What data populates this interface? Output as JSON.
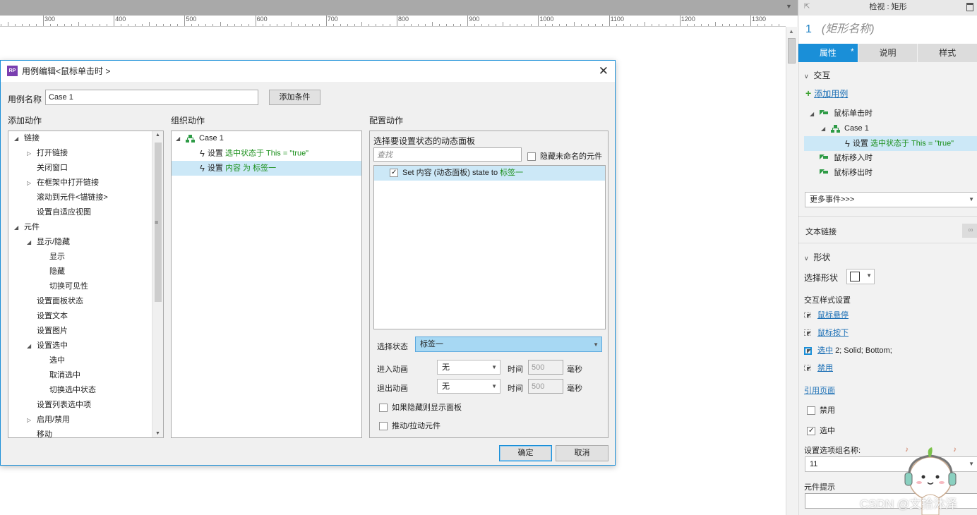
{
  "ruler": {
    "labels": [
      "300",
      "400",
      "500",
      "600",
      "700",
      "800",
      "900",
      "1000",
      "1100",
      "1200",
      "1300"
    ]
  },
  "panel": {
    "header_title": "检视 : 矩形",
    "widget_index": "1",
    "widget_name_placeholder": "(矩形名称)",
    "tabs": [
      {
        "label": "属性",
        "active": true,
        "modified": "*"
      },
      {
        "label": "说明"
      },
      {
        "label": "样式"
      }
    ],
    "interaction_section": "交互",
    "add_case_label": "添加用例",
    "events": [
      {
        "label": "鼠标单击时"
      },
      {
        "label": "鼠标移入时"
      },
      {
        "label": "鼠标移出时"
      }
    ],
    "case_label": "Case 1",
    "action": {
      "prefix": "设置",
      "text": "选中状态于 This = \"true\""
    },
    "more_events": "更多事件>>>",
    "text_link_label": "文本链接",
    "shape_section": "形状",
    "select_shape_label": "选择形状",
    "interaction_styles_label": "交互样式设置",
    "styles": [
      {
        "label": "鼠标悬停",
        "detail": ""
      },
      {
        "label": "鼠标按下",
        "detail": ""
      },
      {
        "label": "选中",
        "detail": "2; Solid; Bottom;"
      },
      {
        "label": "禁用",
        "detail": ""
      }
    ],
    "reference_page": "引用页面",
    "disabled_label": "禁用",
    "selected_label": "选中",
    "group_name_label": "设置选项组名称:",
    "group_name_value": "11",
    "tooltip_label": "元件提示"
  },
  "dialog": {
    "title": "用例编辑<鼠标单击时 >",
    "rp_icon": "RP",
    "case_name_label": "用例名称",
    "case_name_value": "Case 1",
    "add_condition": "添加条件",
    "add_action_header": "添加动作",
    "organize_header": "组织动作",
    "configure_header": "配置动作",
    "action_tree": [
      {
        "level": 0,
        "toggle": "◢",
        "label": "链接"
      },
      {
        "level": 1,
        "toggle": "▷",
        "label": "打开链接"
      },
      {
        "level": 1,
        "toggle": "",
        "label": "关闭窗口"
      },
      {
        "level": 1,
        "toggle": "▷",
        "label": "在框架中打开链接"
      },
      {
        "level": 1,
        "toggle": "",
        "label": "滚动到元件<锚链接>"
      },
      {
        "level": 1,
        "toggle": "",
        "label": "设置自适应视图"
      },
      {
        "level": 0,
        "toggle": "◢",
        "label": "元件"
      },
      {
        "level": 1,
        "toggle": "◢",
        "label": "显示/隐藏"
      },
      {
        "level": 2,
        "toggle": "",
        "label": "显示"
      },
      {
        "level": 2,
        "toggle": "",
        "label": "隐藏"
      },
      {
        "level": 2,
        "toggle": "",
        "label": "切换可见性"
      },
      {
        "level": 1,
        "toggle": "",
        "label": "设置面板状态"
      },
      {
        "level": 1,
        "toggle": "",
        "label": "设置文本"
      },
      {
        "level": 1,
        "toggle": "",
        "label": "设置图片"
      },
      {
        "level": 1,
        "toggle": "◢",
        "label": "设置选中"
      },
      {
        "level": 2,
        "toggle": "",
        "label": "选中"
      },
      {
        "level": 2,
        "toggle": "",
        "label": "取消选中"
      },
      {
        "level": 2,
        "toggle": "",
        "label": "切换选中状态"
      },
      {
        "level": 1,
        "toggle": "",
        "label": "设置列表选中项"
      },
      {
        "level": 1,
        "toggle": "▷",
        "label": "启用/禁用"
      },
      {
        "level": 1,
        "toggle": "",
        "label": "移动"
      }
    ],
    "organize": {
      "case_label": "Case 1",
      "actions": [
        {
          "prefix": "设置",
          "text": "选中状态于 This = \"true\"",
          "selected": false
        },
        {
          "prefix": "设置",
          "text": "内容 为 标签一",
          "selected": true
        }
      ]
    },
    "configure": {
      "panel_title": "选择要设置状态的动态面板",
      "search_placeholder": "查找",
      "hide_unnamed": "隐藏未命名的元件",
      "target": {
        "text": "Set 内容 (动态面板) state to ",
        "state": "标签一",
        "checked": true
      },
      "select_state_label": "选择状态",
      "select_state_value": "标签一",
      "enter_anim_label": "进入动画",
      "exit_anim_label": "退出动画",
      "anim_value": "无",
      "time_label": "时间",
      "time_value": "500",
      "ms_label": "毫秒",
      "show_if_hidden": "如果隐藏则显示面板",
      "push_widgets": "推动/拉动元件"
    },
    "ok": "确定",
    "cancel": "取消"
  },
  "watermark": "CSDN @文拾沐泽",
  "accent_color": "#1a8fd8"
}
